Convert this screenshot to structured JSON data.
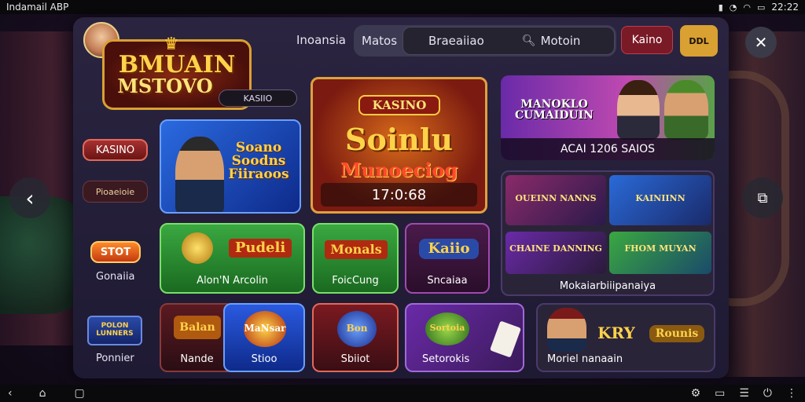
{
  "status_bar": {
    "title": "Indamail ABP",
    "right_text": "22:22"
  },
  "header": {
    "logo_line1": "BMUAIN",
    "logo_line2": "MSTOVO",
    "logo_tag": "KASIIO",
    "links": [
      "Inoansia",
      "Matos"
    ],
    "search_placeholder": "Braeaiiao",
    "search_query": "Motoin",
    "kasino_button": "Kaino",
    "gift_label": "DDL"
  },
  "sidebar": {
    "kasino": "KASINO",
    "promo": "Pioaeioie",
    "slot": "STOT",
    "games_label": "Gonaiia",
    "poker_tile": "POLON LUNNERS",
    "poker_label": "Ponnier"
  },
  "cards": {
    "promo_main": {
      "title": "Soano Soodns Fiiraoos"
    },
    "jackpot": {
      "badge": "KASINO",
      "title_line1": "Soinlu",
      "title_line2": "Munoeciog",
      "timer": "17:0:68"
    },
    "featured": {
      "title": "MANOKLO CUMAIDUIN",
      "caption": "ACAI 1206 SAIOS"
    },
    "card_a": {
      "title": "Pudeli",
      "caption": "Alon'N Arcolin"
    },
    "card_b": {
      "title": "Monals",
      "caption": "FoicCung"
    },
    "card_c": {
      "title": "Kaiio",
      "caption": "Sncaiaa"
    },
    "grid_thumbs": [
      "OUEINN NANNS",
      "KAINIINN",
      "CHAINE DANNING",
      "FHOM MUYAN"
    ],
    "grid_caption": "Mokaiarbiiipanaiya",
    "bottom_1": {
      "title": "Balan",
      "caption": "Nande"
    },
    "bottom_2": {
      "title": "MaNsar",
      "caption": "Stioo"
    },
    "bottom_3": {
      "title": "Bon",
      "caption": "Sbiiot"
    },
    "bottom_4": {
      "title": "Sortoia",
      "caption": "Setorokis"
    },
    "bottom_5": {
      "title1": "KRY",
      "title2": "Rounis",
      "caption": "Moriel nanaain"
    }
  },
  "colors": {
    "panel": "#2a2440",
    "accent_red": "#a83030",
    "accent_gold": "#ffd24a",
    "green": "#2aa04a",
    "blue": "#2a5ae0"
  },
  "icons": [
    "back-arrow-icon",
    "forward-arrow-icon",
    "close-icon",
    "search-icon",
    "gift-icon",
    "home-icon",
    "back-nav-icon"
  ]
}
